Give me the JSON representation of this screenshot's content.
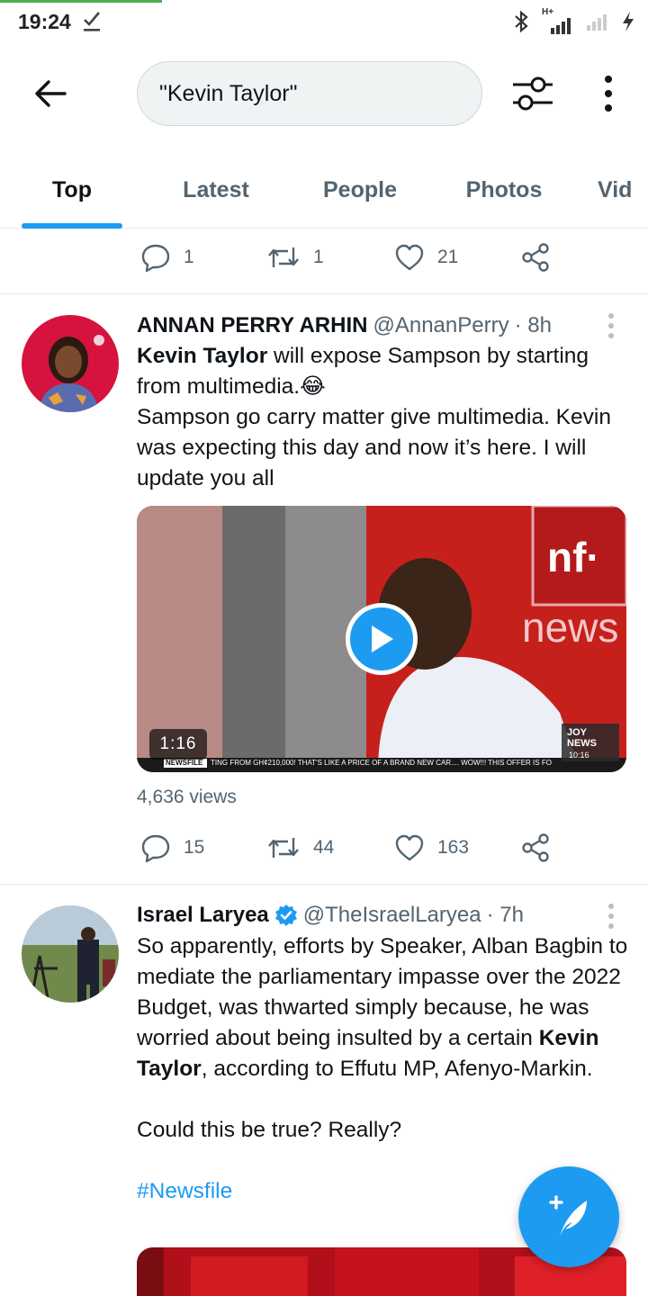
{
  "status_bar": {
    "time": "19:24",
    "network_label": "H+"
  },
  "search": {
    "query": "\"Kevin Taylor\""
  },
  "tabs": [
    {
      "label": "Top",
      "active": true
    },
    {
      "label": "Latest",
      "active": false
    },
    {
      "label": "People",
      "active": false
    },
    {
      "label": "Photos",
      "active": false
    },
    {
      "label": "Vid",
      "active": false
    }
  ],
  "prev_tweet_actions": {
    "replies": "1",
    "retweets": "1",
    "likes": "21"
  },
  "tweets": [
    {
      "name": "ANNAN PERRY ARHIN",
      "handle": "@AnnanPerry",
      "time": "· 8h",
      "verified": false,
      "text_bold": "Kevin Taylor",
      "text_after_bold": " will expose Sampson by starting from multimedia.😂",
      "text_line2": "Sampson go carry matter give multimedia. Kevin was expecting this day and now it’s here. I will update you all",
      "video": {
        "duration": "1:16",
        "channel_logo": "nf·",
        "channel_word": "news",
        "corner_logo": "JOY NEWS",
        "corner_time": "10:16",
        "ticker_label": "NEWSFILE",
        "ticker_text": "TING FROM GH¢210,000! THAT'S LIKE A PRICE OF A BRAND NEW CAR.... WOW!!! THIS OFFER IS FO"
      },
      "views": "4,636 views",
      "replies": "15",
      "retweets": "44",
      "likes": "163"
    },
    {
      "name": "Israel Laryea",
      "handle": "@TheIsraelLaryea",
      "time": "· 7h",
      "verified": true,
      "text_before_bold": "So apparently, efforts by Speaker, Alban Bagbin to mediate the parliamentary impasse over the 2022 Budget, was thwarted simply because, he was worried about being insulted by a certain ",
      "text_bold": "Kevin Taylor",
      "text_after_bold": ", according to Effutu MP, Afenyo-Markin.",
      "text_line2": "Could this be true? Really?",
      "hashtag": "#Newsfile"
    }
  ],
  "colors": {
    "accent": "#1d9bf0",
    "text": "#0f1419",
    "muted": "#536471"
  }
}
